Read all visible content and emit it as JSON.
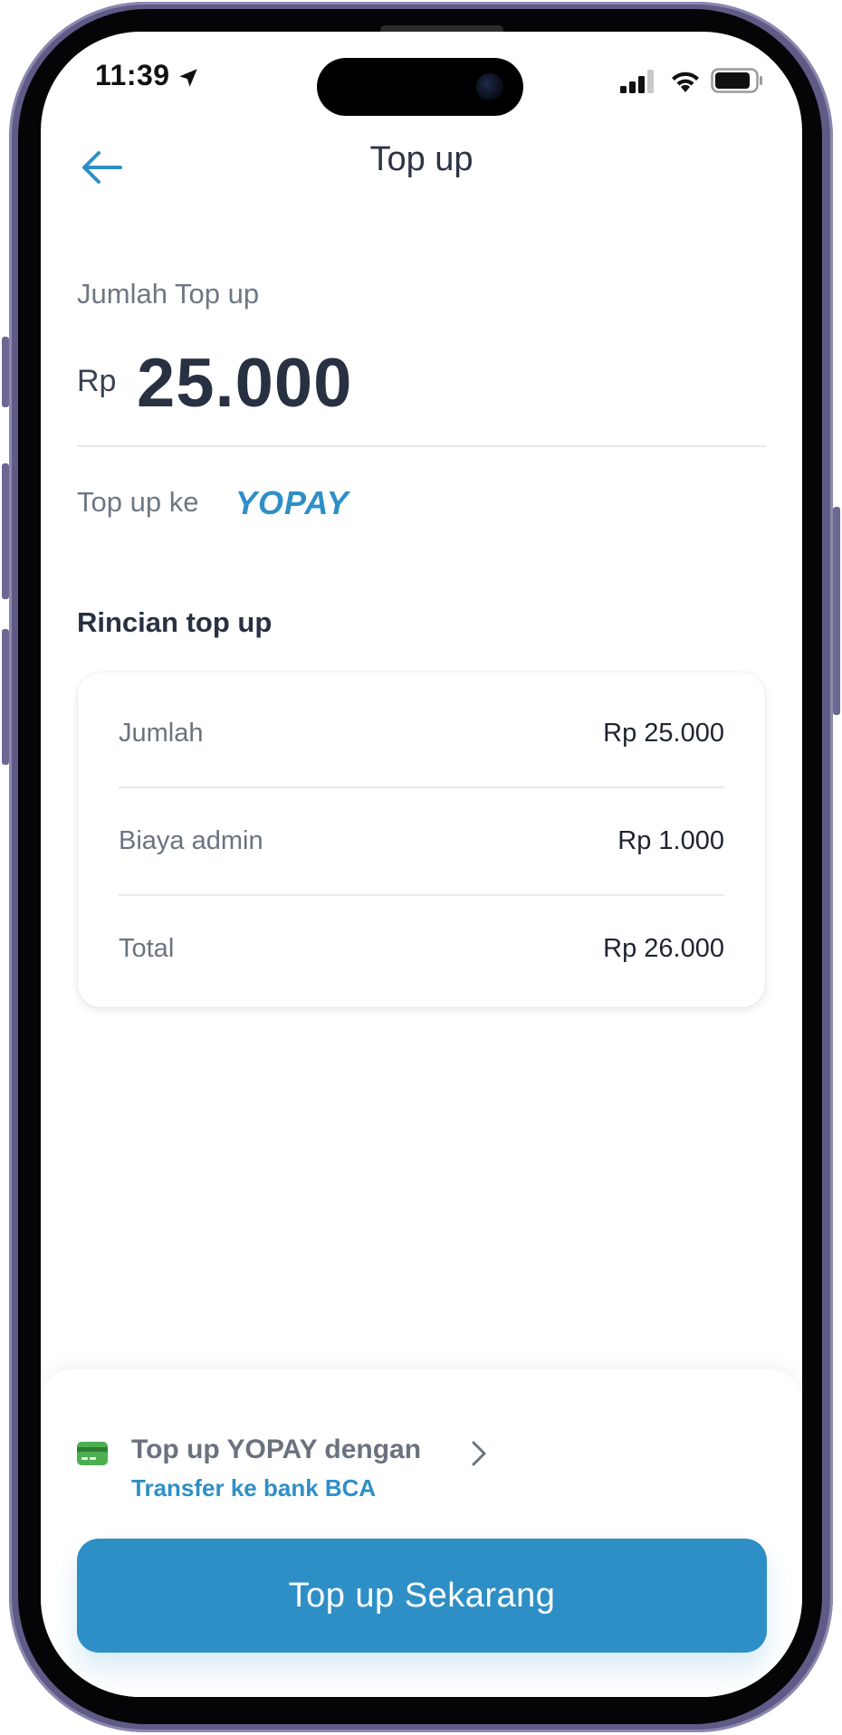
{
  "status_bar": {
    "time": "11:39",
    "location_icon": "location-arrow-icon",
    "signal_icon": "cellular-signal-icon",
    "wifi_icon": "wifi-icon",
    "battery_icon": "battery-icon"
  },
  "header": {
    "back_icon": "arrow-left-icon",
    "title": "Top up"
  },
  "amount": {
    "label": "Jumlah Top up",
    "currency": "Rp",
    "value": "25.000"
  },
  "destination": {
    "label": "Top up ke",
    "brand": "YOPAY"
  },
  "details": {
    "title": "Rincian top up",
    "rows": [
      {
        "label": "Jumlah",
        "value": "Rp 25.000"
      },
      {
        "label": "Biaya admin",
        "value": "Rp 1.000"
      },
      {
        "label": "Total",
        "value": "Rp 26.000"
      }
    ]
  },
  "payment_method": {
    "icon": "credit-card-icon",
    "title": "Top up YOPAY dengan",
    "subtitle": "Transfer ke bank BCA",
    "chevron_icon": "chevron-right-icon"
  },
  "cta": {
    "label": "Top up Sekarang"
  },
  "colors": {
    "accent": "#2e8fc7",
    "text_dark": "#283142",
    "text_muted": "#6f7784",
    "card_icon": "#4caf50"
  }
}
